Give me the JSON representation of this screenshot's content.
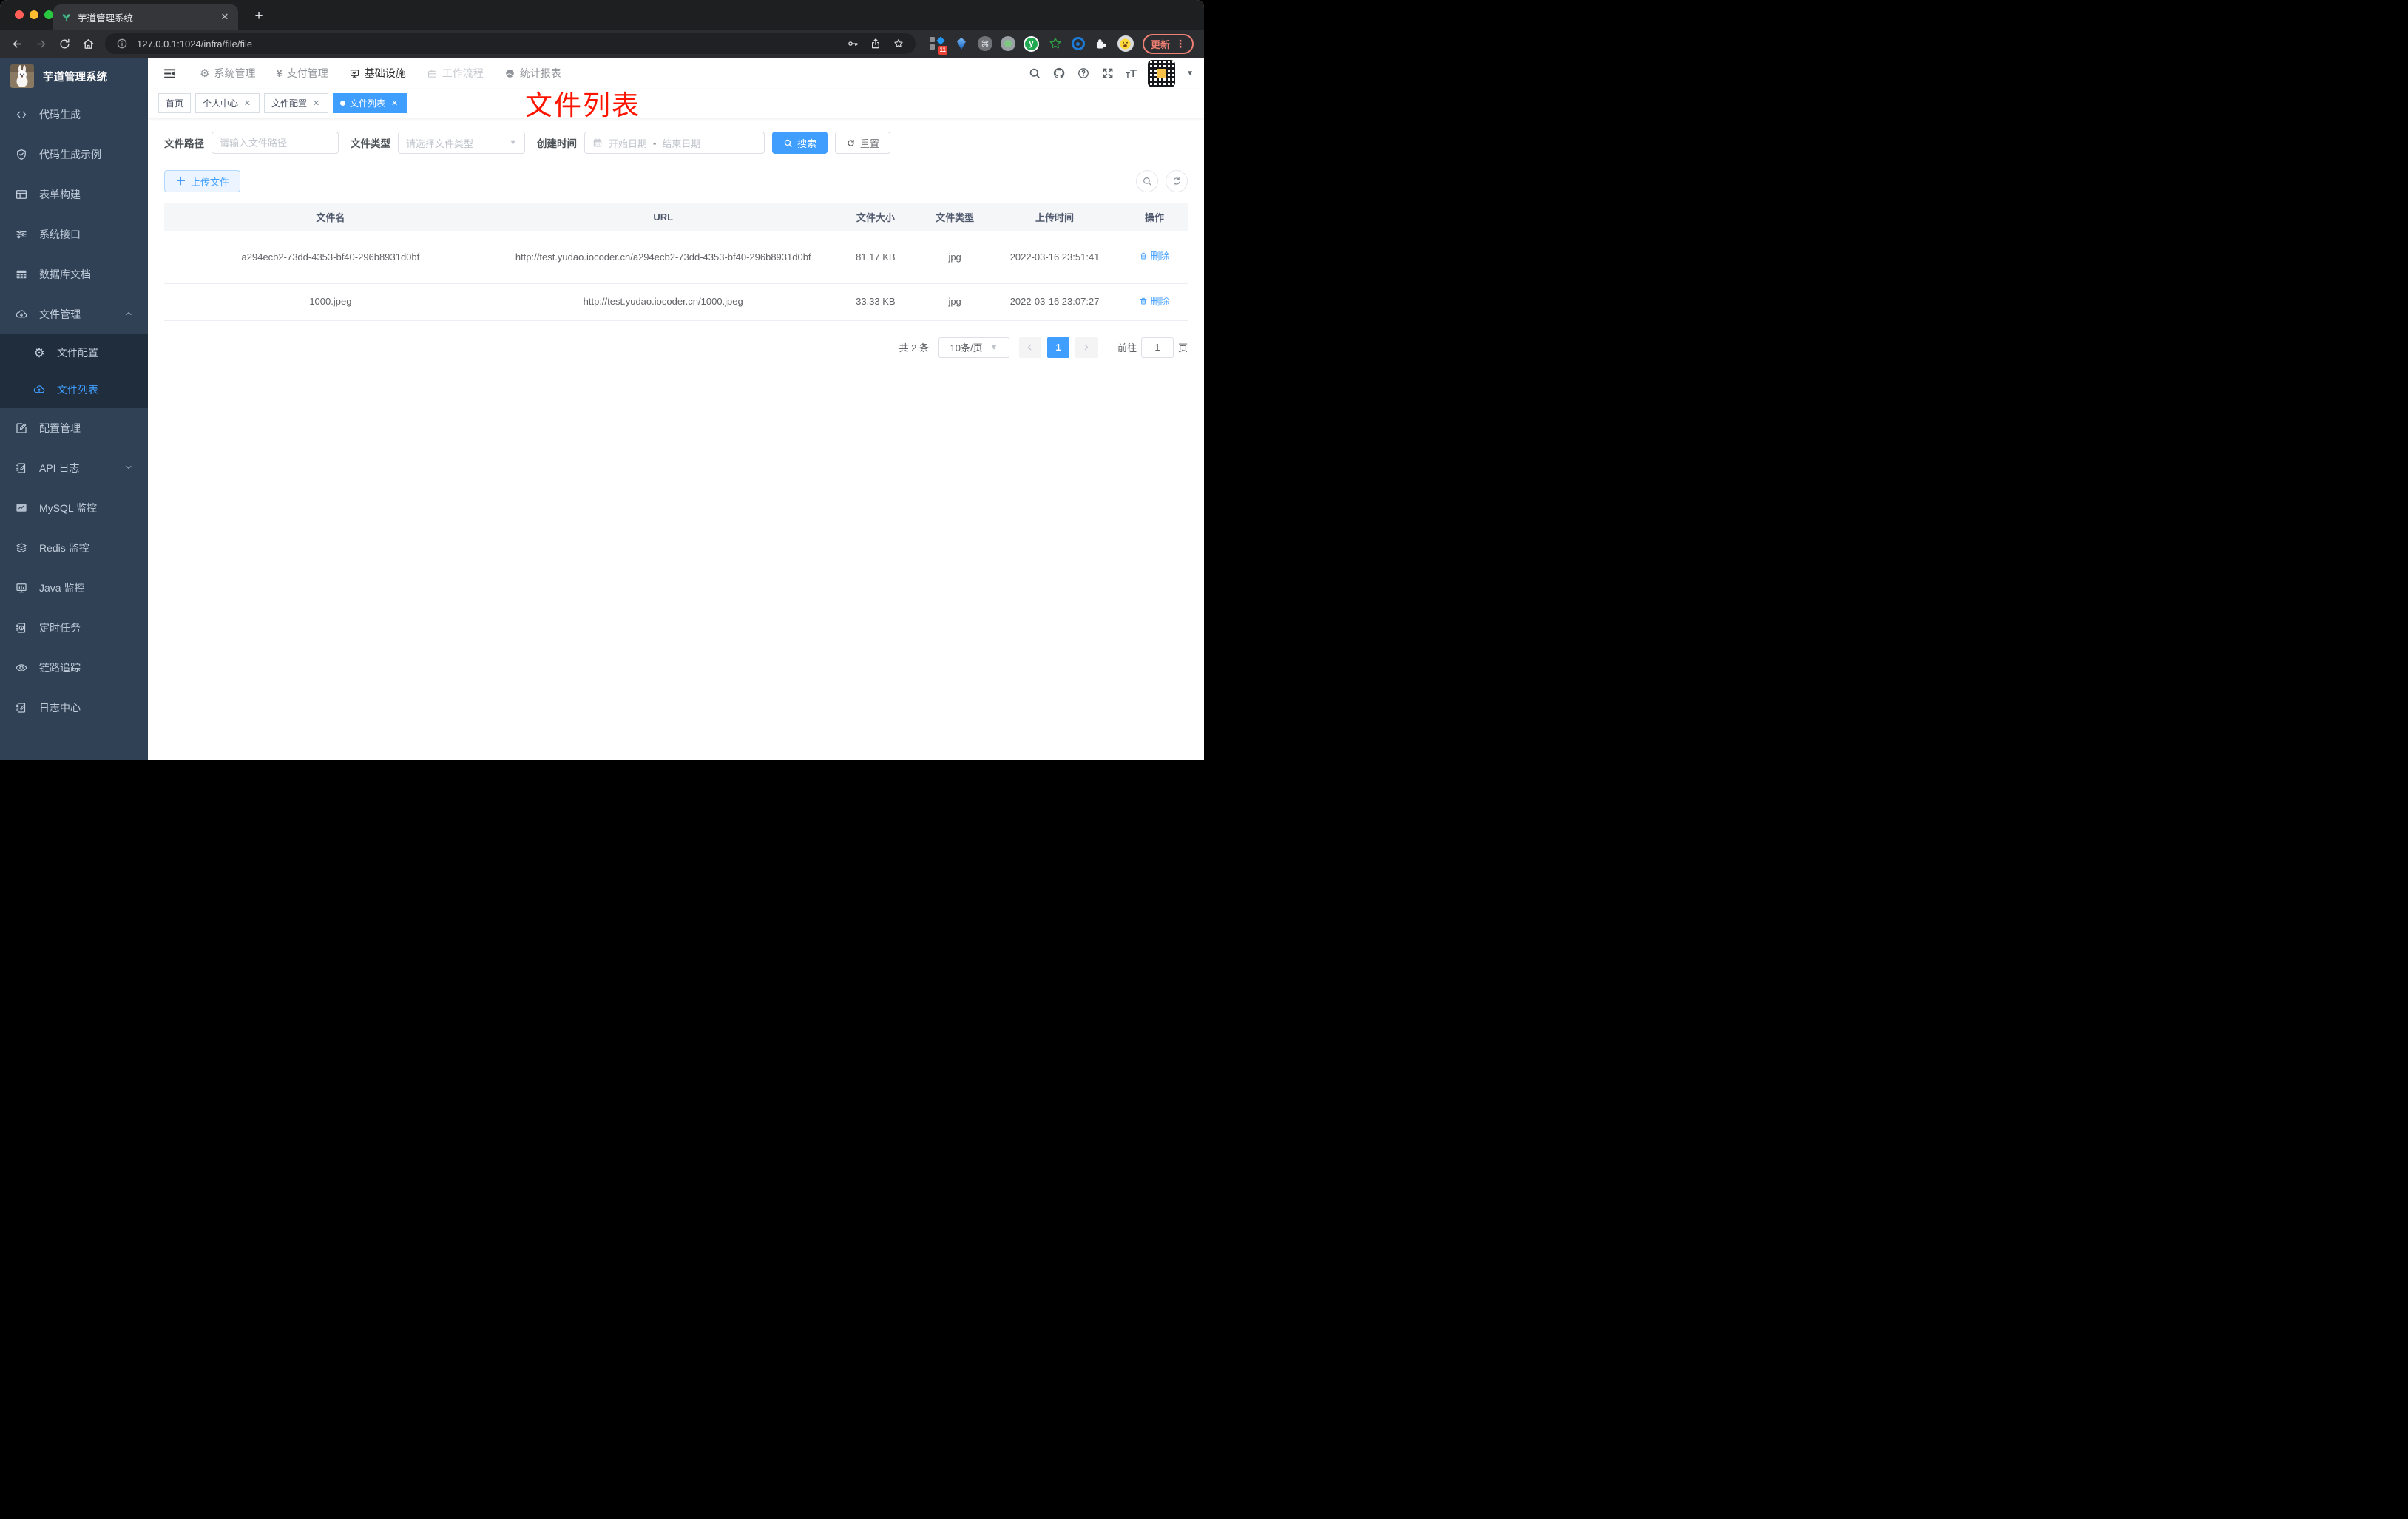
{
  "colors": {
    "accent": "#409eff",
    "sidebar-bg": "#304156",
    "submenu-bg": "#1f2d3d",
    "annotation": "#fd1400",
    "update": "#ee7f73"
  },
  "browser": {
    "tab_title": "芋道管理系统",
    "url": "127.0.0.1:1024/infra/file/file",
    "new_tab": "+",
    "extension_badge": "11",
    "update_button": "更新"
  },
  "header": {
    "menus": [
      {
        "label": "系统管理",
        "icon": "gear"
      },
      {
        "label": "支付管理",
        "icon": "yen"
      },
      {
        "label": "基础设施",
        "icon": "monitor",
        "active": true
      },
      {
        "label": "工作流程",
        "icon": "briefcase"
      },
      {
        "label": "统计报表",
        "icon": "pie"
      }
    ]
  },
  "sidebar": {
    "title": "芋道管理系统",
    "items": [
      {
        "label": "代码生成",
        "icon": "code"
      },
      {
        "label": "代码生成示例",
        "icon": "shield-check"
      },
      {
        "label": "表单构建",
        "icon": "form"
      },
      {
        "label": "系统接口",
        "icon": "sliders"
      },
      {
        "label": "数据库文档",
        "icon": "table-filled"
      },
      {
        "label": "文件管理",
        "icon": "cloud-download",
        "expanded": true
      },
      {
        "label": "文件配置",
        "icon": "gear",
        "submenu": true
      },
      {
        "label": "文件列表",
        "icon": "cloud-upload",
        "submenu": true,
        "active": true
      },
      {
        "label": "配置管理",
        "icon": "edit-square"
      },
      {
        "label": "API 日志",
        "icon": "doc-edit",
        "collapsed": true
      },
      {
        "label": "MySQL 监控",
        "icon": "monitor-chart"
      },
      {
        "label": "Redis 监控",
        "icon": "stack"
      },
      {
        "label": "Java 监控",
        "icon": "monitor-bars"
      },
      {
        "label": "定时任务",
        "icon": "clock-doc"
      },
      {
        "label": "链路追踪",
        "icon": "eye"
      },
      {
        "label": "日志中心",
        "icon": "doc-edit"
      }
    ]
  },
  "tags": {
    "items": [
      {
        "label": "首页",
        "closable": false
      },
      {
        "label": "个人中心",
        "closable": true
      },
      {
        "label": "文件配置",
        "closable": true
      },
      {
        "label": "文件列表",
        "closable": true,
        "active": true
      }
    ],
    "close_glyph": "✕"
  },
  "annotation": "文件列表",
  "filters": {
    "path_label": "文件路径",
    "path_placeholder": "请输入文件路径",
    "type_label": "文件类型",
    "type_placeholder": "请选择文件类型",
    "time_label": "创建时间",
    "start_placeholder": "开始日期",
    "range_separator": "-",
    "end_placeholder": "结束日期",
    "search_label": "搜索",
    "reset_label": "重置"
  },
  "toolbar": {
    "upload_label": "上传文件"
  },
  "table": {
    "columns": [
      "文件名",
      "URL",
      "文件大小",
      "文件类型",
      "上传时间",
      "操作"
    ],
    "rows": [
      {
        "name": "a294ecb2-73dd-4353-bf40-296b8931d0bf",
        "url": "http://test.yudao.iocoder.cn/a294ecb2-73dd-4353-bf40-296b8931d0bf",
        "size": "81.17 KB",
        "type": "jpg",
        "time": "2022-03-16 23:51:41",
        "action": "删除"
      },
      {
        "name": "1000.jpeg",
        "url": "http://test.yudao.iocoder.cn/1000.jpeg",
        "size": "33.33 KB",
        "type": "jpg",
        "time": "2022-03-16 23:07:27",
        "action": "删除"
      }
    ]
  },
  "pagination": {
    "total": "共 2 条",
    "page_size": "10条/页",
    "page": "1",
    "goto_label": "前往",
    "goto_value": "1",
    "unit_label": "页"
  }
}
